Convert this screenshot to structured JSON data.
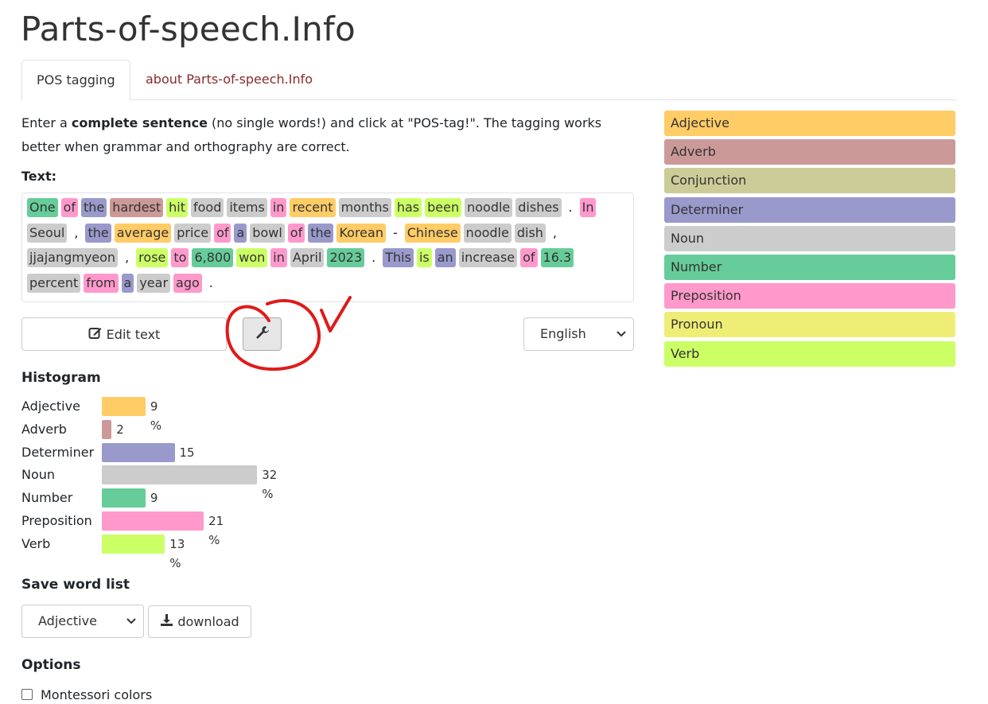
{
  "site": {
    "title": "Parts-of-speech.Info"
  },
  "tabs": [
    {
      "label": "POS tagging",
      "active": true
    },
    {
      "label": "about Parts-of-speech.Info",
      "active": false
    }
  ],
  "intro": {
    "part1": "Enter a ",
    "bold": "complete sentence",
    "part2": " (no single words!) and click at \"POS-tag!\". The tagging works better when grammar and orthography are correct."
  },
  "text_label": "Text:",
  "colors": {
    "Adjective": "#ffcc66",
    "Adverb": "#cc9999",
    "Conjunction": "#cccc99",
    "Determiner": "#9999cc",
    "Noun": "#cccccc",
    "Number": "#66cc99",
    "Preposition": "#ff99cc",
    "Pronoun": "#eeee77",
    "Verb": "#ccff66"
  },
  "tagged_lines": [
    [
      {
        "t": "One",
        "pos": "Number"
      },
      {
        "t": "of",
        "pos": "Preposition"
      },
      {
        "t": "the",
        "pos": "Determiner"
      },
      {
        "t": "hardest",
        "pos": "Adverb"
      },
      {
        "t": "hit",
        "pos": "Verb"
      },
      {
        "t": "food",
        "pos": "Noun"
      },
      {
        "t": "items",
        "pos": "Noun"
      },
      {
        "t": "in",
        "pos": "Preposition"
      },
      {
        "t": "recent",
        "pos": "Adjective"
      },
      {
        "t": "months",
        "pos": "Noun"
      },
      {
        "t": "has",
        "pos": "Verb"
      },
      {
        "t": "been",
        "pos": "Verb"
      },
      {
        "t": "noodle",
        "pos": "Noun"
      },
      {
        "t": "dishes",
        "pos": "Noun"
      },
      {
        "t": ".",
        "pos": ""
      },
      {
        "t": "In",
        "pos": "Preposition"
      }
    ],
    [
      {
        "t": "Seoul",
        "pos": "Noun"
      },
      {
        "t": ",",
        "pos": ""
      },
      {
        "t": "the",
        "pos": "Determiner"
      },
      {
        "t": "average",
        "pos": "Adjective"
      },
      {
        "t": "price",
        "pos": "Noun"
      },
      {
        "t": "of",
        "pos": "Preposition"
      },
      {
        "t": "a",
        "pos": "Determiner"
      },
      {
        "t": "bowl",
        "pos": "Noun"
      },
      {
        "t": "of",
        "pos": "Preposition"
      },
      {
        "t": "the",
        "pos": "Determiner"
      },
      {
        "t": "Korean",
        "pos": "Adjective"
      },
      {
        "t": "-",
        "pos": ""
      },
      {
        "t": "Chinese",
        "pos": "Adjective"
      },
      {
        "t": "noodle",
        "pos": "Noun"
      },
      {
        "t": "dish",
        "pos": "Noun"
      },
      {
        "t": ",",
        "pos": ""
      }
    ],
    [
      {
        "t": "jjajangmyeon",
        "pos": "Noun"
      },
      {
        "t": ",",
        "pos": ""
      },
      {
        "t": "rose",
        "pos": "Verb"
      },
      {
        "t": "to",
        "pos": "Preposition"
      },
      {
        "t": "6,800",
        "pos": "Number"
      },
      {
        "t": "won",
        "pos": "Verb"
      },
      {
        "t": "in",
        "pos": "Preposition"
      },
      {
        "t": "April",
        "pos": "Noun"
      },
      {
        "t": "2023",
        "pos": "Number"
      },
      {
        "t": ".",
        "pos": ""
      },
      {
        "t": "This",
        "pos": "Determiner"
      },
      {
        "t": "is",
        "pos": "Verb"
      },
      {
        "t": "an",
        "pos": "Determiner"
      },
      {
        "t": "increase",
        "pos": "Noun"
      },
      {
        "t": "of",
        "pos": "Preposition"
      },
      {
        "t": "16.3",
        "pos": "Number"
      }
    ],
    [
      {
        "t": "percent",
        "pos": "Noun"
      },
      {
        "t": "from",
        "pos": "Preposition"
      },
      {
        "t": "a",
        "pos": "Determiner"
      },
      {
        "t": "year",
        "pos": "Noun"
      },
      {
        "t": "ago",
        "pos": "Preposition"
      },
      {
        "t": ".",
        "pos": ""
      }
    ]
  ],
  "buttons": {
    "edit_text": "Edit text",
    "download": "download"
  },
  "language_select": {
    "selected": "English"
  },
  "histogram": {
    "title": "Histogram",
    "rows": [
      {
        "label": "Adjective",
        "pct": 9,
        "pct_label": "9 %"
      },
      {
        "label": "Adverb",
        "pct": 2,
        "pct_label": "2 %"
      },
      {
        "label": "Determiner",
        "pct": 15,
        "pct_label": "15 %"
      },
      {
        "label": "Noun",
        "pct": 32,
        "pct_label": "32 %"
      },
      {
        "label": "Number",
        "pct": 9,
        "pct_label": "9 %"
      },
      {
        "label": "Preposition",
        "pct": 21,
        "pct_label": "21 %"
      },
      {
        "label": "Verb",
        "pct": 13,
        "pct_label": "13 %"
      }
    ]
  },
  "save_word_list": {
    "title": "Save word list",
    "selected": "Adjective"
  },
  "options": {
    "title": "Options",
    "montessori_label": "Montessori colors",
    "montessori_checked": false
  },
  "legend": [
    "Adjective",
    "Adverb",
    "Conjunction",
    "Determiner",
    "Noun",
    "Number",
    "Preposition",
    "Pronoun",
    "Verb"
  ],
  "icons": {
    "edit": "edit-icon",
    "wrench": "wrench-icon",
    "download": "download-icon",
    "chevron": "chevron-down-icon",
    "annotation": "annotation-circle-check"
  }
}
